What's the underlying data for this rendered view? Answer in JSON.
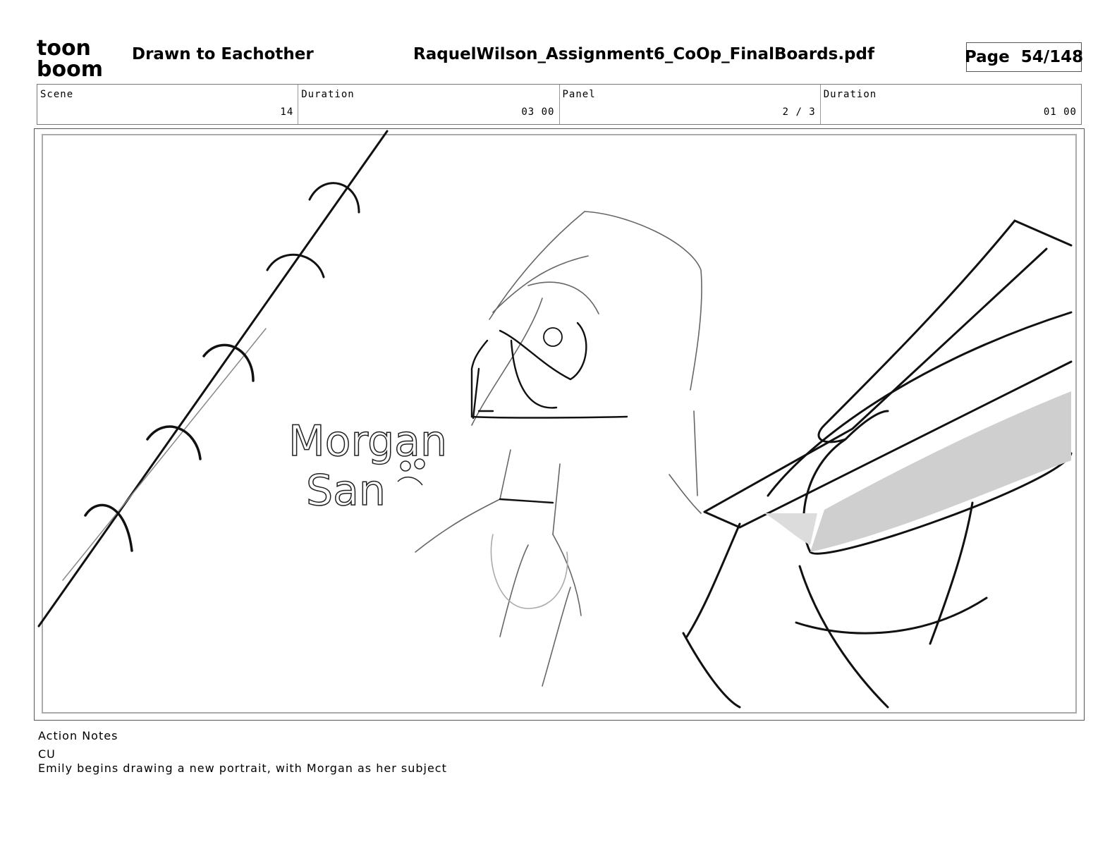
{
  "header": {
    "logo_text_top": "toon",
    "logo_text_bottom": "boom",
    "project_title": "Drawn to Eachother",
    "file_name": "RaquelWilson_Assignment6_CoOp_FinalBoards.pdf",
    "page_label": "Page",
    "page_value": "54/148"
  },
  "info": {
    "scene_label": "Scene",
    "scene_value": "14",
    "duration_label": "Duration",
    "duration_value": "03 00",
    "panel_label": "Panel",
    "panel_value": "2 / 3",
    "panel_duration_label": "Duration",
    "panel_duration_value": "01 00"
  },
  "panel": {
    "sketch_text_line1": "Morgan",
    "sketch_text_line2": "San"
  },
  "notes": {
    "label": "Action Notes",
    "line1": "CU",
    "line2": "Emily begins drawing a new portrait, with Morgan as her subject"
  }
}
